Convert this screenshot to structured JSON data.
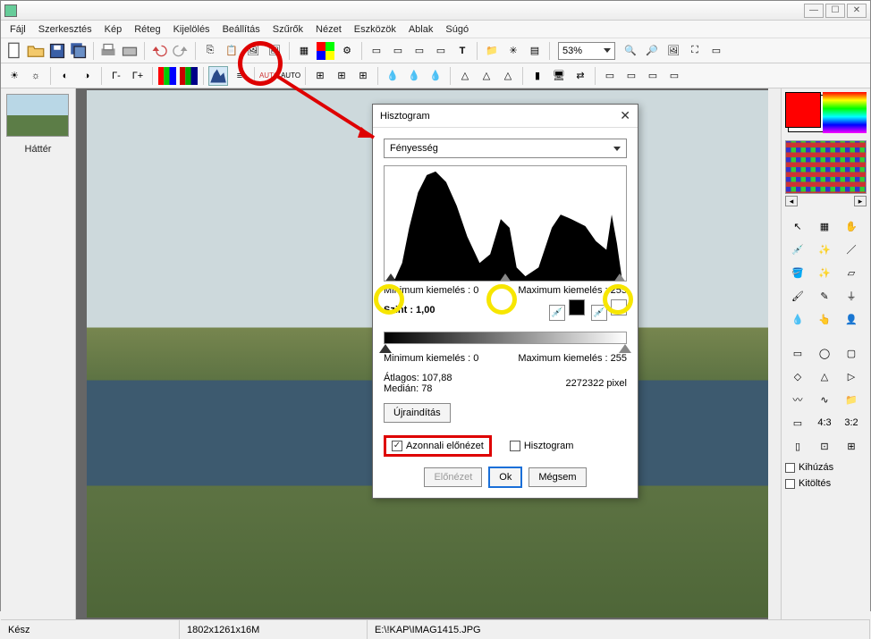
{
  "menus": [
    "Fájl",
    "Szerkesztés",
    "Kép",
    "Réteg",
    "Kijelölés",
    "Beállítás",
    "Szűrők",
    "Nézet",
    "Eszközök",
    "Ablak",
    "Súgó"
  ],
  "zoom": "53%",
  "thumbnail_label": "Háttér",
  "dialog": {
    "title": "Hisztogram",
    "channel": "Fényesség",
    "min_label": "Minimum kiemelés : 0",
    "max_label": "Maximum kiemelés : 255",
    "szint": "Szint : 1,00",
    "min2": "Minimum kiemelés : 0",
    "max2": "Maximum kiemelés : 255",
    "atlag": "Átlagos: 107,88",
    "median": "Medián: 78",
    "pixels": "2272322 pixel",
    "restart": "Újraindítás",
    "preview_chk": "Azonnali előnézet",
    "histogram_chk": "Hisztogram",
    "preview_btn": "Előnézet",
    "ok": "Ok",
    "cancel": "Mégsem"
  },
  "right": {
    "kihuzas": "Kihúzás",
    "kitoltes": "Kitöltés"
  },
  "status": {
    "ready": "Kész",
    "dims": "1802x1261x16M",
    "path": "E:\\!KAP\\IMAG1415.JPG"
  },
  "chart_data": {
    "type": "area",
    "title": "Hisztogram",
    "xlabel": "",
    "ylabel": "",
    "xlim": [
      0,
      255
    ],
    "ylim": [
      0,
      1
    ],
    "values_shape": "unimodal-left-skew with secondary peak near 180 and small cluster near 255"
  }
}
